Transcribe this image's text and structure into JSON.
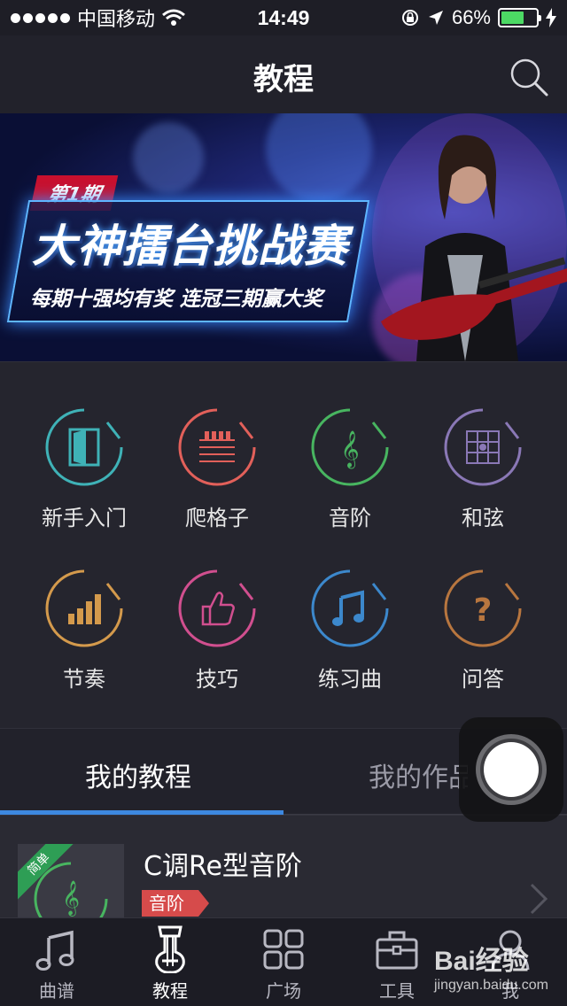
{
  "status_bar": {
    "carrier": "中国移动",
    "time": "14:49",
    "battery_percent": "66%",
    "battery_level": 0.66
  },
  "nav": {
    "title": "教程",
    "search_icon": "search-icon"
  },
  "banner": {
    "issue": "第1期",
    "title": "大神擂台挑战赛",
    "subtitle": "每期十强均有奖 连冠三期赢大奖"
  },
  "categories": [
    {
      "label": "新手入门",
      "icon": "door-icon",
      "color": "#3fb2b7"
    },
    {
      "label": "爬格子",
      "icon": "fretboard-icon",
      "color": "#e2605a"
    },
    {
      "label": "音阶",
      "icon": "treble-clef-icon",
      "color": "#48b560"
    },
    {
      "label": "和弦",
      "icon": "chord-grid-icon",
      "color": "#8a78b6"
    },
    {
      "label": "节奏",
      "icon": "bars-icon",
      "color": "#d49a4c"
    },
    {
      "label": "技巧",
      "icon": "thumbs-up-icon",
      "color": "#d14f8f"
    },
    {
      "label": "练习曲",
      "icon": "music-note-icon",
      "color": "#3c88cc"
    },
    {
      "label": "问答",
      "icon": "question-icon",
      "color": "#b8763f"
    }
  ],
  "tabs": {
    "my_courses": "我的教程",
    "my_works": "我的作品"
  },
  "course": {
    "badge": "简单",
    "title": "C调Re型音阶",
    "tag": "音阶"
  },
  "tab_bar": [
    {
      "label": "曲谱",
      "icon": "music-note-icon"
    },
    {
      "label": "教程",
      "icon": "guitar-icon"
    },
    {
      "label": "广场",
      "icon": "grid-icon"
    },
    {
      "label": "工具",
      "icon": "toolbox-icon"
    },
    {
      "label": "我",
      "icon": "person-icon"
    }
  ],
  "watermark": {
    "logo": "Bai经验",
    "url": "jingyan.baidu.com"
  }
}
